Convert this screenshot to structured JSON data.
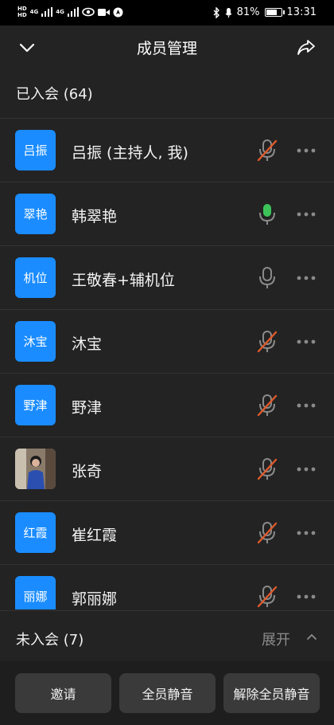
{
  "statusbar": {
    "left_badges": [
      "HD",
      "4G",
      "4G"
    ],
    "bluetooth_icon": "bluetooth-icon",
    "battery": "81%",
    "battery_level": 0.81,
    "time": "13:31"
  },
  "header": {
    "title": "成员管理",
    "back_icon": "chevron-down-icon",
    "share_icon": "share-icon"
  },
  "joined": {
    "title": "已入会 (64)"
  },
  "members": [
    {
      "avatar_text": "吕振",
      "name": "吕振 (主持人, 我)",
      "mic": "muted"
    },
    {
      "avatar_text": "翠艳",
      "name": "韩翠艳",
      "mic": "active"
    },
    {
      "avatar_text": "机位",
      "name": "王敬春+辅机位",
      "mic": "unmuted"
    },
    {
      "avatar_text": "沐宝",
      "name": "沐宝",
      "mic": "muted"
    },
    {
      "avatar_text": "野津",
      "name": "野津",
      "mic": "muted"
    },
    {
      "avatar_text": "",
      "name": "张奇",
      "mic": "muted",
      "photo": true
    },
    {
      "avatar_text": "红霞",
      "name": "崔红霞",
      "mic": "muted"
    },
    {
      "avatar_text": "丽娜",
      "name": "郭丽娜",
      "mic": "muted"
    }
  ],
  "not_joined": {
    "title": "未入会 (7)",
    "expand_label": "展开"
  },
  "buttons": {
    "invite": "邀请",
    "mute_all": "全员静音",
    "unmute_all": "解除全员静音"
  },
  "colors": {
    "accent": "#1a8cff",
    "muted": "#e05a2b",
    "active": "#3cc35a"
  }
}
